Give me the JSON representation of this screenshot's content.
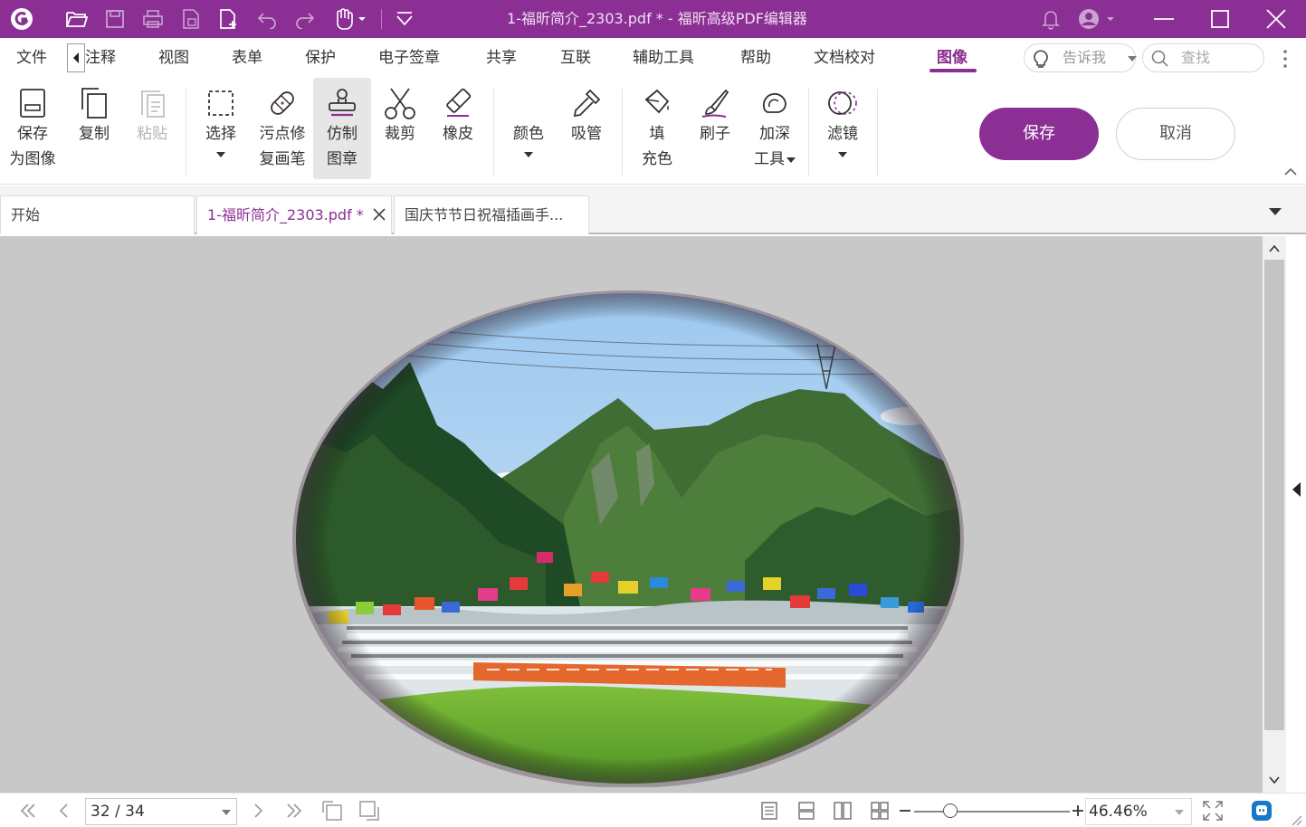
{
  "window": {
    "title": "1-福昕简介_2303.pdf * - 福昕高级PDF编辑器",
    "accent": "#8b2f94"
  },
  "quick_access": [
    "foxit-logo-icon",
    "open-folder-icon",
    "save-icon",
    "print-icon",
    "export-page-icon",
    "new-page-icon",
    "undo-icon",
    "redo-icon",
    "hand-tool-icon",
    "customize-icon"
  ],
  "menu": {
    "items": [
      "文件",
      "注释",
      "视图",
      "表单",
      "保护",
      "电子签章",
      "共享",
      "互联",
      "辅助工具",
      "帮助",
      "文档校对",
      "图像"
    ],
    "active": "图像",
    "tell_me": "告诉我",
    "search": "查找"
  },
  "ribbon": {
    "save_as_image": [
      "保存",
      "为图像"
    ],
    "copy": "复制",
    "paste": "粘贴",
    "select": "选择",
    "spot_heal": [
      "污点修",
      "复画笔"
    ],
    "clone_stamp": [
      "仿制",
      "图章"
    ],
    "crop": "裁剪",
    "eraser": "橡皮",
    "color": "颜色",
    "eyedropper": "吸管",
    "fill": [
      "填",
      "充色"
    ],
    "brush": "刷子",
    "burn": [
      "加深",
      "工具"
    ],
    "filter": "滤镜",
    "save_button": "保存",
    "cancel_button": "取消"
  },
  "tabs": [
    {
      "label": "开始",
      "active": false
    },
    {
      "label": "1-福昕简介_2303.pdf *",
      "active": true
    },
    {
      "label": "国庆节节日祝福插画手...",
      "active": false
    }
  ],
  "document": {
    "image_description_icon": "group-photo-oval-image"
  },
  "status": {
    "page": "32 / 34",
    "zoom": "46.46%",
    "zoom_level": 0.2
  }
}
